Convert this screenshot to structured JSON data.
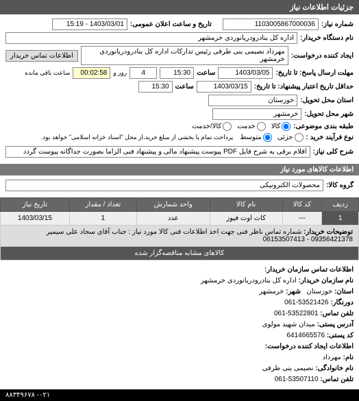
{
  "header": {
    "title": "جزئیات اطلاعات نیاز"
  },
  "form": {
    "req_no_label": "شماره نیاز:",
    "req_no": "1103005867000036",
    "announce_label": "تاریخ و ساعت اعلان عمومی:",
    "announce_date": "1403/03/01 - 15:19",
    "cust_name_label": "نام دستگاه خریدار:",
    "cust_name": "اداره کل بنادرودریانوردی خرمشهر",
    "creator_label": "ایجاد کننده درخواست:",
    "creator": "مهرداد  نصیمی بنی طرفی رئیس تدارکات اداره کل بنادرودریانوردی خرمشهر",
    "contact_btn": "اطلاعات تماس خریدار",
    "deadline_label": "مهلت ارسال پاسخ: تا تاریخ:",
    "deadline_date": "1403/03/05",
    "time_label": "ساعت",
    "deadline_time": "15:30",
    "day_word": "روز و",
    "days_left": "4",
    "remain_time": "00:02:58",
    "remain_label": "ساعت باقی مانده",
    "valid_label": "حداقل تاریخ اعتبار پیشنهاد: تا تاریخ:",
    "valid_date": "1403/03/15",
    "valid_time": "15:30",
    "delivery_prov_label": "استان محل تحویل:",
    "delivery_prov": "خوزستان",
    "delivery_city_label": "شهر محل تحویل:",
    "delivery_city": "خرمشهر",
    "category_label": "طبقه بندی موضوعی:",
    "cat_goods": "کالا",
    "cat_service": "خدمت",
    "cat_both": "کالا/خدمت",
    "purchase_label": "نوع فرآیند خرید :",
    "pt_small": "جزئی",
    "pt_medium": "متوسط",
    "pt_note": "پرداخت تمام یا بخشی از مبلغ خرید،از محل \"اسناد خزانه اسلامی\" خواهد بود.",
    "desc_label": "شرح کلی نیاز:",
    "desc": "اقلام برقی به شرح فایل PDF پیوست پیشنهاد مالی و پیشنهاد فنی الزاما بصورت جداگانه پیوست گردد"
  },
  "goods_header": "اطلاعات کالاهای مورد نیاز",
  "group_label": "گروه کالا:",
  "group_value": "محصولات الکترونیکی",
  "table": {
    "h_row": "ردیف",
    "h_code": "کد کالا",
    "h_name": "نام کالا",
    "h_unit": "واحد شمارش",
    "h_qty": "تعداد / مقدار",
    "h_date": "تاریخ نیاز",
    "rows": [
      {
        "idx": "1",
        "code": "---",
        "name": "کات اوت فیوز",
        "unit": "عدد",
        "qty": "1",
        "date": "1403/03/15"
      }
    ],
    "details_label": "توضیحات خریدار:",
    "details_text": "شماره تماس ناظر فنی جهت اخذ اطلاعات فنی کالا مورد نیاز : جناب آقای سجاد علی سیمیر 09356421378 - 06153507413",
    "sub_row": "کالاهای مشابه مناقصه‌گزار شده"
  },
  "footer": {
    "title": "اطلاعات تماس سازمان خریدار:",
    "org_label": "نام سازمان خریدار:",
    "org": "اداره کل بنادرودریانوردی خرمشهر",
    "prov_label": "استان:",
    "prov": "خوزستان",
    "city_label": "شهر:",
    "city": "خرمشهر",
    "fax_label": "دورنگار:",
    "fax": "53521426-061",
    "phone_label": "تلفن تماس:",
    "phone": "53522801-061",
    "addr_label": "آدرس پستی:",
    "addr": "میدان شهید مولوی",
    "zip_label": "کد پستی:",
    "zip": "6414665576",
    "creator2_label": "اطلاعات ایجاد کننده درخواست:",
    "fname_label": "نام:",
    "fname": "مهرداد",
    "lname_label": "نام خانوادگی:",
    "lname": "نصیمی بنی طرفی",
    "phone2_label": "تلفن تماس:",
    "phone2": "53507110-061"
  },
  "bottom": "۸۸۳۴۹۶۷۸ -۰۲۱"
}
